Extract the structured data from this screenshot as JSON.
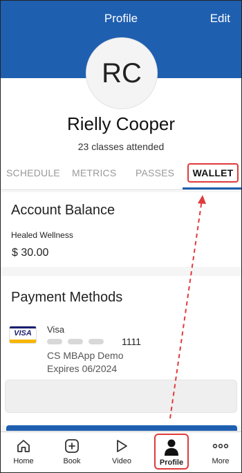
{
  "header": {
    "title": "Profile",
    "edit_label": "Edit",
    "brand_color": "#1f5fb0"
  },
  "profile": {
    "initials": "RC",
    "name": "Rielly Cooper",
    "classes_attended": "23 classes attended"
  },
  "tabs": [
    {
      "label": "SCHEDULE"
    },
    {
      "label": "METRICS"
    },
    {
      "label": "PASSES"
    },
    {
      "label": "WALLET",
      "selected": true
    }
  ],
  "account_balance": {
    "title": "Account Balance",
    "studio": "Healed Wellness",
    "amount": "$ 30.00"
  },
  "payment_methods": {
    "title": "Payment Methods",
    "cards": [
      {
        "logo": "VISA",
        "brand": "Visa",
        "last4": "1111",
        "name": "CS MBApp Demo",
        "expires": "Expires 06/2024"
      }
    ]
  },
  "bottom_nav": [
    {
      "label": "Home",
      "icon": "home-icon"
    },
    {
      "label": "Book",
      "icon": "plus-square-icon"
    },
    {
      "label": "Video",
      "icon": "play-icon"
    },
    {
      "label": "Profile",
      "icon": "person-icon",
      "selected": true
    },
    {
      "label": "More",
      "icon": "more-dots-icon"
    }
  ],
  "annotation": {
    "highlight_color": "#e03a3a"
  }
}
